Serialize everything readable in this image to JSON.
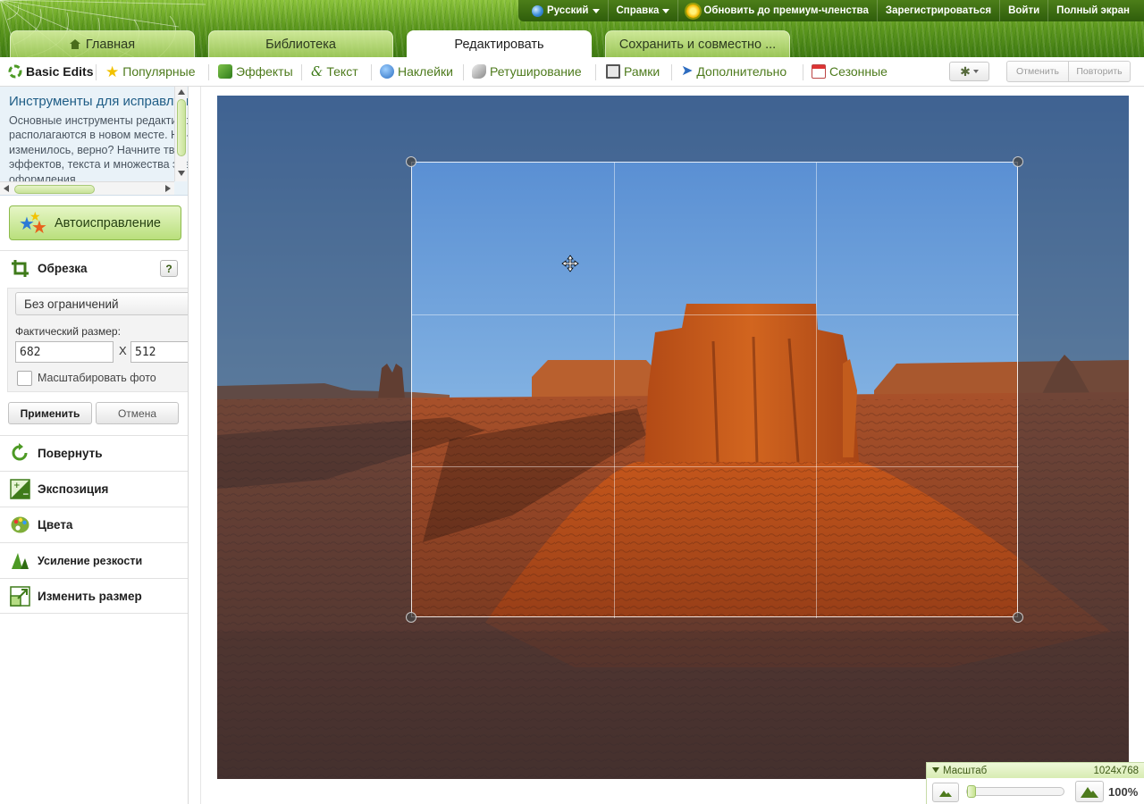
{
  "topbar": {
    "language": "Русский",
    "help": "Справка",
    "upgrade": "Обновить до премиум-членства",
    "register": "Зарегистрироваться",
    "login": "Войти",
    "fullscreen": "Полный экран"
  },
  "tabs": [
    {
      "label": "Главная"
    },
    {
      "label": "Библиотека"
    },
    {
      "label": "Редактировать",
      "active": true
    },
    {
      "label": "Сохранить и совместно ..."
    }
  ],
  "toolbar": {
    "tools": [
      {
        "label": "Basic Edits",
        "icon": "basic-edits-icon"
      },
      {
        "label": "Популярные",
        "icon": "star-icon"
      },
      {
        "label": "Эффекты",
        "icon": "effects-icon"
      },
      {
        "label": "Текст",
        "icon": "text-icon"
      },
      {
        "label": "Наклейки",
        "icon": "sticker-icon"
      },
      {
        "label": "Ретуширование",
        "icon": "retouch-icon"
      },
      {
        "label": "Рамки",
        "icon": "frames-icon"
      },
      {
        "label": "Дополнительно",
        "icon": "pin-icon"
      },
      {
        "label": "Сезонные",
        "icon": "calendar-icon"
      }
    ],
    "undo": "Отменить",
    "redo": "Повторить"
  },
  "sidebar": {
    "tip_title": "Инструменты для исправления",
    "tip_text": [
      "Основные инструменты редактирования",
      "располагаются в новом месте. Ничего не",
      "изменилось, верно? Начните творить с помощью",
      "эффектов, текста и множества элементов",
      "оформления"
    ],
    "autofix": "Автоисправление",
    "crop": {
      "title": "Обрезка",
      "help": "?",
      "ratio": "Без ограничений",
      "size_label": "Фактический размер:",
      "width": "682",
      "height": "512",
      "x_label": "X",
      "scale_label": "Масштабировать фото",
      "apply": "Применить",
      "cancel": "Отмена"
    },
    "sections": [
      {
        "label": "Повернуть",
        "icon": "rotate-icon"
      },
      {
        "label": "Экспозиция",
        "icon": "exposure-icon"
      },
      {
        "label": "Цвета",
        "icon": "palette-icon"
      },
      {
        "label": "Усиление резкости",
        "icon": "sharpen-icon"
      },
      {
        "label": "Изменить размер",
        "icon": "resize-icon"
      }
    ]
  },
  "zoom": {
    "title": "Масштаб",
    "dimensions": "1024x768",
    "level": "100%",
    "slider_fraction": 0.0
  },
  "colors": {
    "accent_green": "#4d7a1c",
    "tip_title": "#1f5d86"
  }
}
